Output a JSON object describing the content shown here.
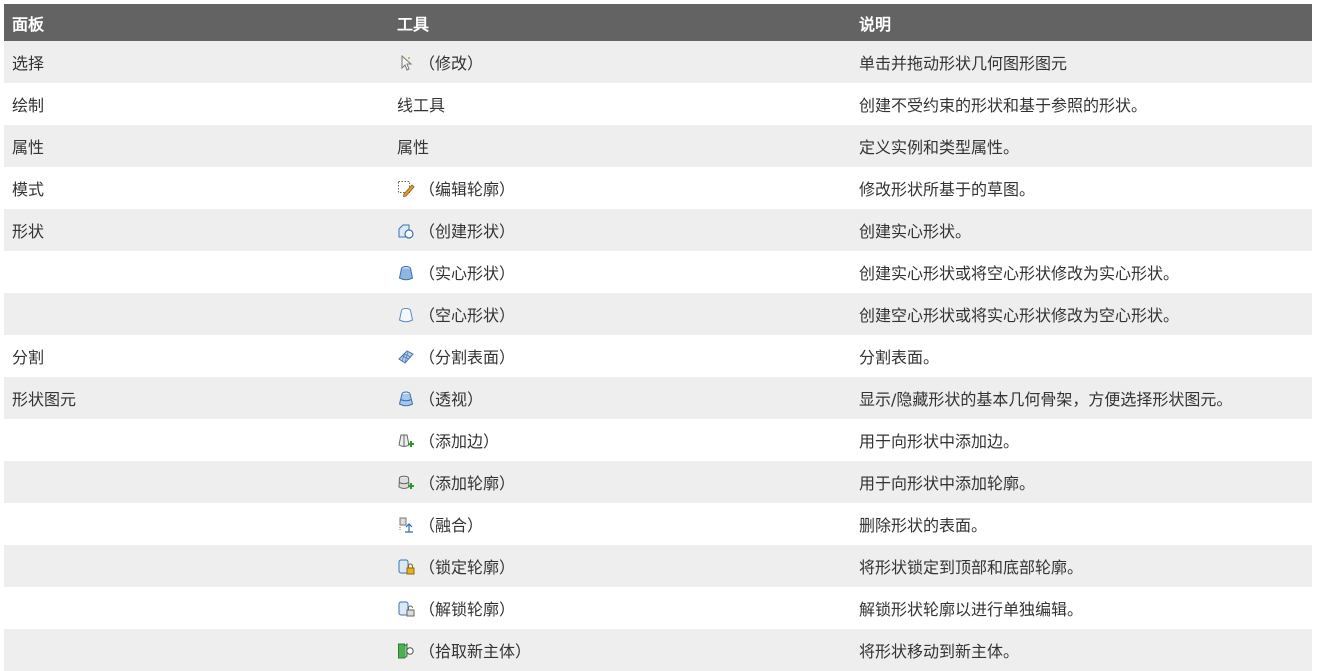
{
  "headers": {
    "panel": "面板",
    "tool": "工具",
    "desc": "说明"
  },
  "rows": [
    {
      "panel": "选择",
      "icon": "modify-cursor-icon",
      "tool": "（修改）",
      "desc": "单击并拖动形状几何图形图元"
    },
    {
      "panel": "绘制",
      "icon": "",
      "tool": "线工具",
      "desc": "创建不受约束的形状和基于参照的形状。"
    },
    {
      "panel": "属性",
      "icon": "",
      "tool": "属性",
      "desc": "定义实例和类型属性。"
    },
    {
      "panel": "模式",
      "icon": "edit-profile-icon",
      "tool": "（编辑轮廓）",
      "desc": "修改形状所基于的草图。"
    },
    {
      "panel": "形状",
      "icon": "create-form-icon",
      "tool": "（创建形状）",
      "desc": "创建实心形状。"
    },
    {
      "panel": "",
      "icon": "solid-form-icon",
      "tool": "（实心形状）",
      "desc": "创建实心形状或将空心形状修改为实心形状。"
    },
    {
      "panel": "",
      "icon": "void-form-icon",
      "tool": "（空心形状）",
      "desc": "创建空心形状或将实心形状修改为空心形状。"
    },
    {
      "panel": "分割",
      "icon": "divide-surface-icon",
      "tool": "（分割表面）",
      "desc": "分割表面。"
    },
    {
      "panel": "形状图元",
      "icon": "xray-icon",
      "tool": "（透视）",
      "desc": "显示/隐藏形状的基本几何骨架，方便选择形状图元。"
    },
    {
      "panel": "",
      "icon": "add-edge-icon",
      "tool": "（添加边）",
      "desc": "用于向形状中添加边。"
    },
    {
      "panel": "",
      "icon": "add-profile-icon",
      "tool": "（添加轮廓）",
      "desc": "用于向形状中添加轮廓。"
    },
    {
      "panel": "",
      "icon": "dissolve-icon",
      "tool": "（融合）",
      "desc": "删除形状的表面。"
    },
    {
      "panel": "",
      "icon": "lock-profiles-icon",
      "tool": "（锁定轮廓）",
      "desc": "将形状锁定到顶部和底部轮廓。"
    },
    {
      "panel": "",
      "icon": "unlock-profile-icon",
      "tool": "（解锁轮廓）",
      "desc": "解锁形状轮廓以进行单独编辑。"
    },
    {
      "panel": "",
      "icon": "pick-new-host-icon",
      "tool": "（拾取新主体）",
      "desc": "将形状移动到新主体。"
    }
  ]
}
